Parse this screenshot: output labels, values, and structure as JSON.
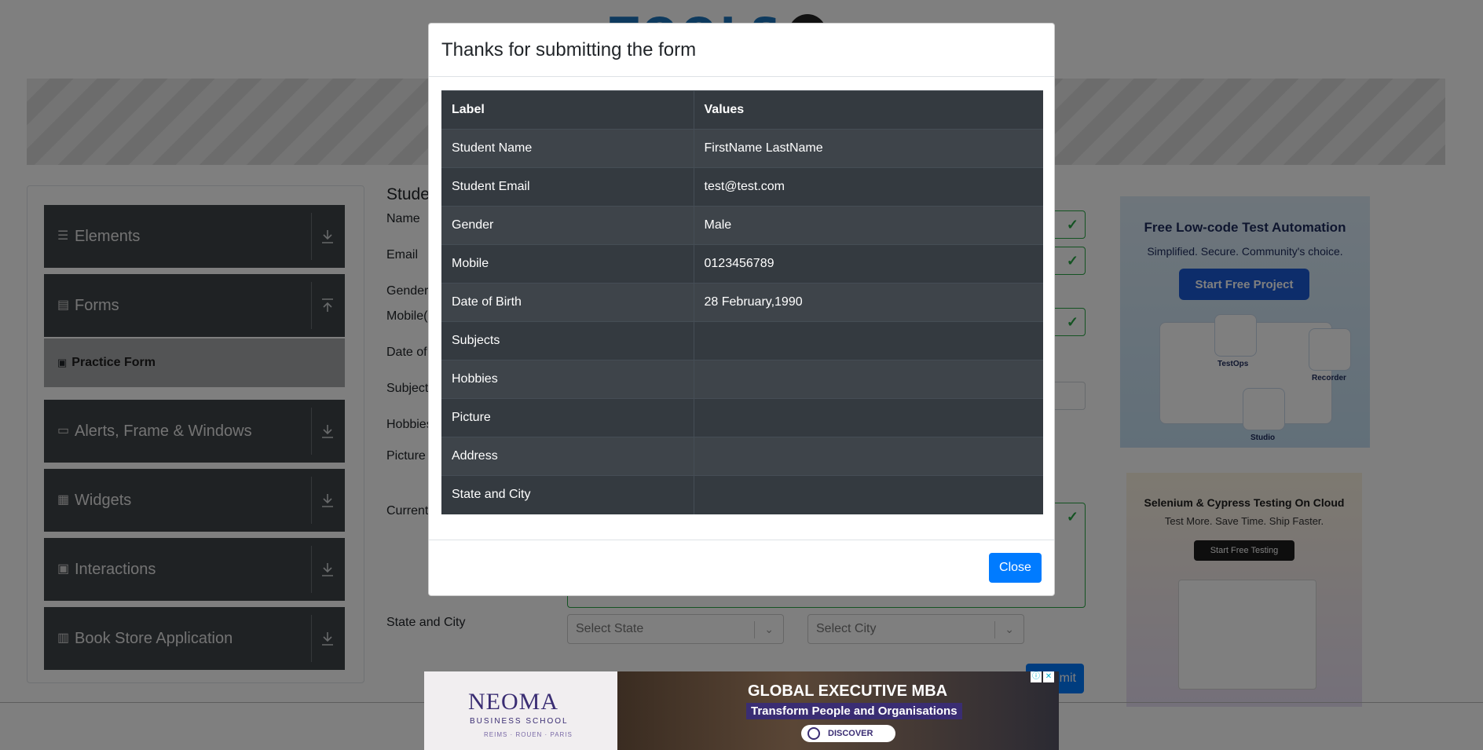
{
  "sidebar": {
    "groups": [
      {
        "label": "Elements",
        "icon": "menu-icon"
      },
      {
        "label": "Forms",
        "icon": "document-icon"
      },
      {
        "label": "Alerts, Frame & Windows",
        "icon": "window-icon"
      },
      {
        "label": "Widgets",
        "icon": "widgets-icon"
      },
      {
        "label": "Interactions",
        "icon": "interactions-icon"
      },
      {
        "label": "Book Store Application",
        "icon": "books-icon"
      }
    ],
    "active_item": "Practice Form"
  },
  "form": {
    "title_partial": "Stude",
    "labels": {
      "name": "Name",
      "email": "Email",
      "gender": "Gender",
      "mobile": "Mobile(",
      "dob": "Date of",
      "subjects": "Subject",
      "hobbies": "Hobbies",
      "picture": "Picture",
      "address": "Current",
      "state_city": "State and City"
    },
    "state_placeholder": "Select State",
    "city_placeholder": "Select City",
    "submit_label": "mit"
  },
  "ads": {
    "right1": {
      "title": "Free Low-code Test Automation",
      "subtitle": "Simplified. Secure. Community's choice.",
      "button": "Start Free Project",
      "tags": [
        "TestOps",
        "Recorder",
        "Studio"
      ]
    },
    "right2": {
      "title": "Selenium & Cypress Testing On Cloud",
      "subtitle": "Test More. Save Time. Ship Faster.",
      "button": "Start Free Testing"
    },
    "bottom": {
      "brand": "NEOMA",
      "school": "BUSINESS SCHOOL",
      "cities": "REIMS · ROUEN · PARIS",
      "headline": "GLOBAL EXECUTIVE MBA",
      "tagline": "Transform People and Organisations",
      "cta": "DISCOVER"
    }
  },
  "modal": {
    "title": "Thanks for submitting the form",
    "headers": [
      "Label",
      "Values"
    ],
    "rows": [
      {
        "label": "Student Name",
        "value": "FirstName LastName"
      },
      {
        "label": "Student Email",
        "value": "test@test.com"
      },
      {
        "label": "Gender",
        "value": "Male"
      },
      {
        "label": "Mobile",
        "value": "0123456789"
      },
      {
        "label": "Date of Birth",
        "value": "28 February,1990"
      },
      {
        "label": "Subjects",
        "value": ""
      },
      {
        "label": "Hobbies",
        "value": ""
      },
      {
        "label": "Picture",
        "value": ""
      },
      {
        "label": "Address",
        "value": ""
      },
      {
        "label": "State and City",
        "value": ""
      }
    ],
    "close_label": "Close"
  }
}
